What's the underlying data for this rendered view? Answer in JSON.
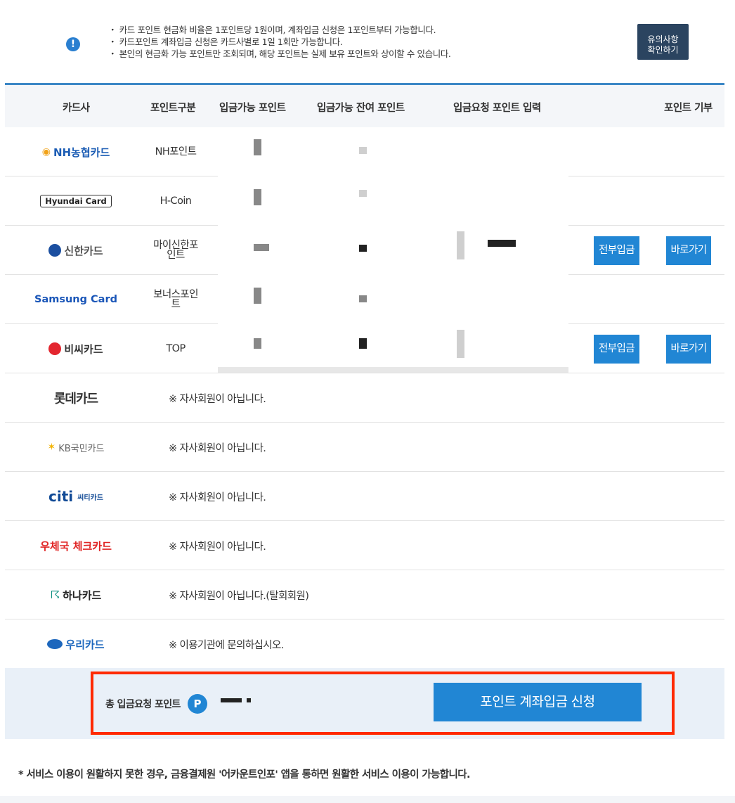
{
  "notice": {
    "lines": [
      "・ 카드 포인트 현금화 비율은 1포인트당 1원이며, 계좌입금 신청은 1포인트부터 가능합니다.",
      "・ 카드포인트 계좌입금 신청은 카드사별로 1일 1회만 가능합니다.",
      "・ 본인의 현금화 가능 포인트만 조회되며, 해당 포인트는 실제 보유 포인트와 상이할 수 있습니다."
    ],
    "button_line1": "유의사항",
    "button_line2": "확인하기",
    "icon": "exclamation-icon"
  },
  "headers": {
    "card_company": "카드사",
    "point_type": "포인트구분",
    "available_points": "입금가능 포인트",
    "remaining_points": "입금가능 잔여 포인트",
    "request_input": "입금요청 포인트 입력",
    "donate": "포인트 기부"
  },
  "members": [
    {
      "logo_text": "NH농협카드",
      "point_type": "NH포인트"
    },
    {
      "logo_text": "Hyundai Card",
      "point_type": "H-Coin"
    },
    {
      "logo_text": "신한카드",
      "point_type_1": "마이신한포",
      "point_type_2": "인트",
      "deposit_all": "전부입금",
      "go": "바로가기"
    },
    {
      "logo_text": "Samsung Card",
      "point_type_1": "보너스포인",
      "point_type_2": "트"
    },
    {
      "logo_text": "비씨카드",
      "point_type": "TOP",
      "deposit_all": "전부입금",
      "go": "바로가기"
    }
  ],
  "non_members": [
    {
      "logo_text": "롯데카드",
      "message": "※ 자사회원이 아닙니다."
    },
    {
      "logo_text": "KB국민카드",
      "message": "※ 자사회원이 아닙니다."
    },
    {
      "logo_text": "citi",
      "logo_sub": "씨티카드",
      "message": "※ 자사회원이 아닙니다."
    },
    {
      "logo_text": "우체국 체크카드",
      "message": "※ 자사회원이 아닙니다."
    },
    {
      "logo_text": "하나카드",
      "message": "※ 자사회원이 아닙니다.(탈회회원)"
    },
    {
      "logo_text": "우리카드",
      "message": "※ 이용기관에 문의하십시오."
    }
  ],
  "total": {
    "label": "총 입금요청 포인트",
    "p_icon": "P",
    "apply_button": "포인트 계좌입금 신청"
  },
  "footnote": "* 서비스 이용이 원활하지 못한 경우, 금융결제원 '어카운트인포' 앱을 통하면 원활한 서비스 이용이 가능합니다.",
  "colors": {
    "accent_blue": "#2186d4",
    "notice_button": "#2b4460",
    "highlight_border": "#ff2a00"
  }
}
